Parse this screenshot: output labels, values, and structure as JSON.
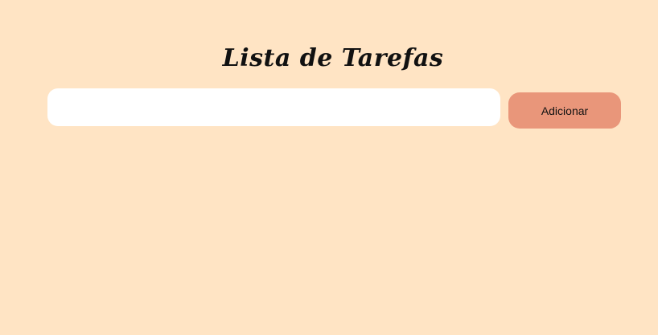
{
  "app": {
    "title": "Lista de Tarefas"
  },
  "form": {
    "task_input": {
      "value": "",
      "placeholder": ""
    },
    "add_label": "Adicionar"
  },
  "colors": {
    "background": "#ffe4c4",
    "button": "#e9967a",
    "input_background": "#ffffff"
  }
}
